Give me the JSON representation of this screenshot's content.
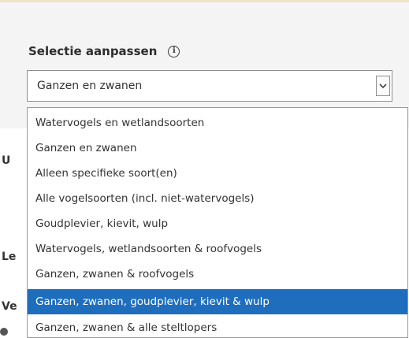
{
  "selection": {
    "label": "Selectie aanpassen",
    "info_icon": "info-icon",
    "current_value": "Ganzen en zwanen",
    "arrow_icon": "chevron-down-icon"
  },
  "dropdown": {
    "options": [
      "Watervogels en wetlandsoorten",
      "Ganzen en zwanen",
      "Alleen specifieke soort(en)",
      "Alle vogelsoorten (incl. niet-watervogels)",
      "Goudplevier, kievit, wulp",
      "Watervogels, wetlandsoorten & roofvogels",
      "Ganzen, zwanen & roofvogels",
      "Ganzen, zwanen, goudplevier, kievit & wulp",
      "Ganzen, zwanen & alle steltlopers"
    ],
    "highlighted_index": 7,
    "highlight_color": "#1f6ebe"
  },
  "background_labels": {
    "label_1": "U",
    "label_2": "Le",
    "label_3": "Ve"
  }
}
